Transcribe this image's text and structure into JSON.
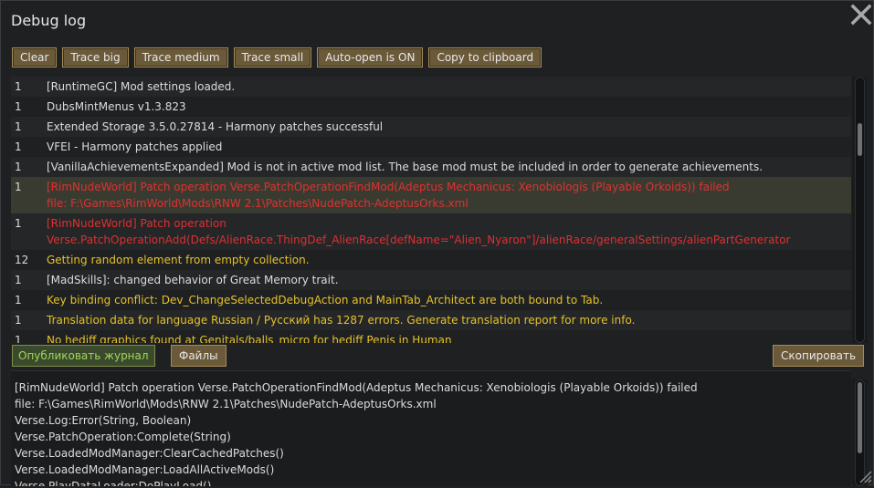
{
  "window": {
    "title": "Debug log"
  },
  "toolbar": {
    "buttons": [
      "Clear",
      "Trace big",
      "Trace medium",
      "Trace small",
      "Auto-open is ON",
      "Copy to clipboard"
    ]
  },
  "log": {
    "rows": [
      {
        "count": "1",
        "lines": [
          "[RuntimeGC] Mod settings loaded."
        ],
        "color": "white"
      },
      {
        "count": "1",
        "lines": [
          "DubsMintMenus v1.3.823"
        ],
        "color": "white"
      },
      {
        "count": "1",
        "lines": [
          "Extended Storage 3.5.0.27814 - Harmony patches successful"
        ],
        "color": "white"
      },
      {
        "count": "1",
        "lines": [
          "VFEI - Harmony patches applied"
        ],
        "color": "white"
      },
      {
        "count": "1",
        "lines": [
          "[VanillaAchievementsExpanded] Mod is not in active mod list. The base mod must be included in order to generate achievements."
        ],
        "color": "white"
      },
      {
        "count": "1",
        "lines": [
          "[RimNudeWorld] Patch operation Verse.PatchOperationFindMod(Adeptus Mechanicus: Xenobiologis (Playable Orkoids)) failed",
          "file: F:\\Games\\RimWorld\\Mods\\RNW 2.1\\Patches\\NudePatch-AdeptusOrks.xml"
        ],
        "color": "red",
        "selected": true
      },
      {
        "count": "1",
        "lines": [
          "[RimNudeWorld] Patch operation",
          "Verse.PatchOperationAdd(Defs/AlienRace.ThingDef_AlienRace[defName=\"Alien_Nyaron\"]/alienRace/generalSettings/alienPartGenerator"
        ],
        "color": "red"
      },
      {
        "count": "12",
        "lines": [
          "Getting random element from empty collection."
        ],
        "color": "yellow"
      },
      {
        "count": "1",
        "lines": [
          "[MadSkills]: changed behavior of Great Memory trait."
        ],
        "color": "white"
      },
      {
        "count": "1",
        "lines": [
          "Key binding conflict: Dev_ChangeSelectedDebugAction and MainTab_Architect are both bound to Tab."
        ],
        "color": "yellow"
      },
      {
        "count": "1",
        "lines": [
          "Translation data for language Russian / Русский has 1287 errors. Generate translation report for more info."
        ],
        "color": "yellow"
      },
      {
        "count": "1",
        "lines": [
          "No hediff graphics found at Genitals/balls_micro for hediff Penis in Human"
        ],
        "color": "yellow"
      }
    ]
  },
  "bottombar": {
    "publish_label": "Опубликовать журнал",
    "files_label": "Файлы",
    "copy_label": "Скопировать"
  },
  "detail": {
    "lines": [
      "[RimNudeWorld] Patch operation Verse.PatchOperationFindMod(Adeptus Mechanicus: Xenobiologis (Playable Orkoids)) failed",
      "file: F:\\Games\\RimWorld\\Mods\\RNW 2.1\\Patches\\NudePatch-AdeptusOrks.xml",
      "Verse.Log:Error(String, Boolean)",
      "Verse.PatchOperation:Complete(String)",
      "Verse.LoadedModManager:ClearCachedPatches()",
      "Verse.LoadedModManager:LoadAllActiveMods()",
      "Verse.PlayDataLoader:DoPlayLoad()"
    ]
  },
  "colors": {
    "white": "#dcdcdc",
    "red": "#e03030",
    "yellow": "#e6c229",
    "button_bg": "#6b5a3a",
    "button_border": "#a58b56",
    "green_text": "#9ed65a"
  },
  "icons": {
    "close": "close-icon",
    "resize": "resize-grip-icon"
  }
}
